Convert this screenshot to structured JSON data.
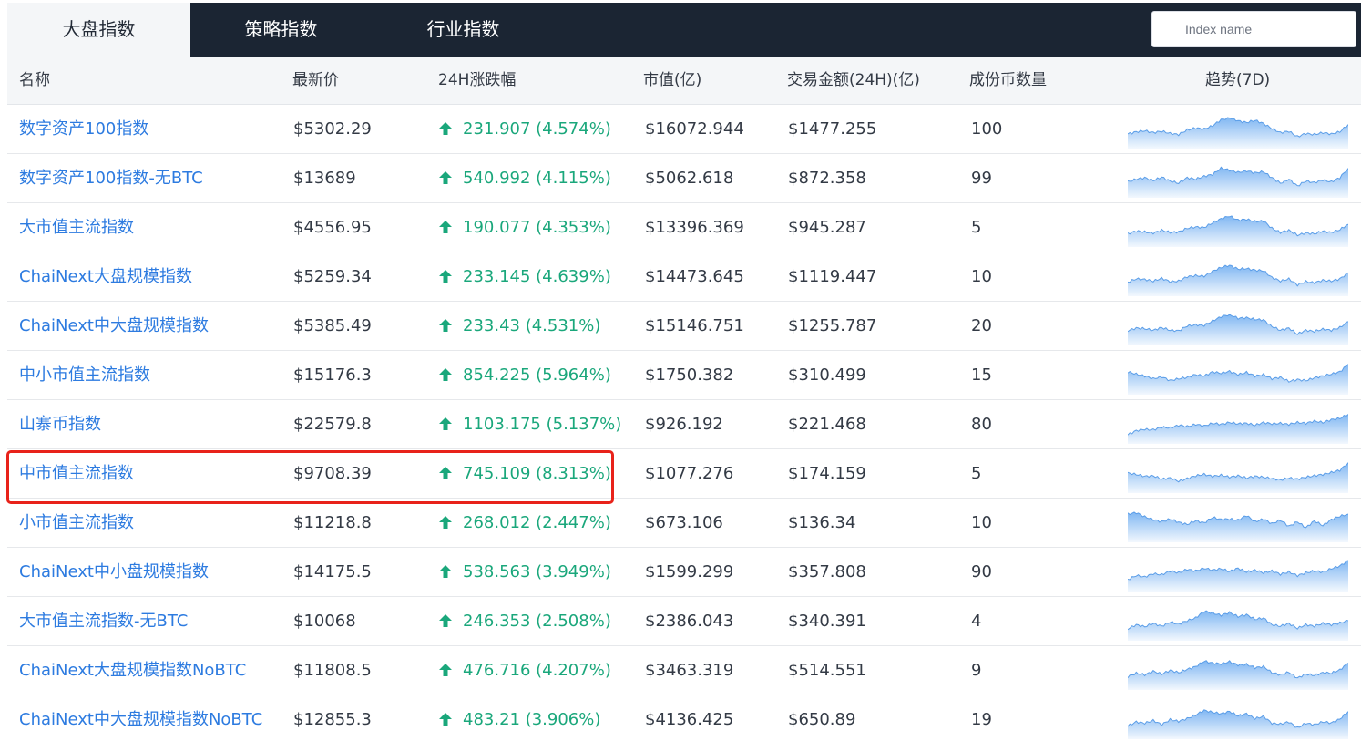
{
  "tabs": [
    {
      "label": "大盘指数",
      "active": true
    },
    {
      "label": "策略指数",
      "active": false
    },
    {
      "label": "行业指数",
      "active": false
    }
  ],
  "search": {
    "placeholder": "Index name",
    "value": ""
  },
  "columns": {
    "name": "名称",
    "price": "最新价",
    "change": "24H涨跌幅",
    "market_cap": "市值(亿)",
    "volume": "交易金额(24H)(亿)",
    "constituents": "成份币数量",
    "trend": "趋势(7D)"
  },
  "colors": {
    "link": "#2d7be0",
    "up": "#1aa77b",
    "header_bg": "#1b2533",
    "highlight": "#e8221a",
    "sparkline": "#6aaaf0"
  },
  "rows": [
    {
      "name": "数字资产100指数",
      "price": "$5302.29",
      "change": "231.907 (4.574%)",
      "direction": "up",
      "market_cap": "$16072.944",
      "volume": "$1477.255",
      "constituents": "100",
      "trend": [
        0.4,
        0.48,
        0.52,
        0.45,
        0.5,
        0.42,
        0.38,
        0.55,
        0.62,
        0.58,
        0.7,
        0.92,
        1.0,
        0.88,
        0.82,
        0.9,
        0.78,
        0.6,
        0.45,
        0.5,
        0.3,
        0.42,
        0.38,
        0.45,
        0.4,
        0.48,
        0.75
      ]
    },
    {
      "name": "数字资产100指数-无BTC",
      "price": "$13689",
      "change": "540.992 (4.115%)",
      "direction": "up",
      "market_cap": "$5062.618",
      "volume": "$872.358",
      "constituents": "99",
      "trend": [
        0.45,
        0.55,
        0.6,
        0.5,
        0.62,
        0.48,
        0.4,
        0.6,
        0.55,
        0.65,
        0.72,
        0.95,
        0.88,
        0.8,
        0.85,
        0.78,
        0.82,
        0.6,
        0.4,
        0.55,
        0.3,
        0.48,
        0.42,
        0.52,
        0.45,
        0.6,
        0.95
      ]
    },
    {
      "name": "大市值主流指数",
      "price": "$4556.95",
      "change": "190.077 (4.353%)",
      "direction": "up",
      "market_cap": "$13396.369",
      "volume": "$945.287",
      "constituents": "5",
      "trend": [
        0.35,
        0.45,
        0.42,
        0.38,
        0.48,
        0.4,
        0.42,
        0.55,
        0.6,
        0.58,
        0.75,
        0.9,
        1.0,
        0.85,
        0.88,
        0.8,
        0.82,
        0.55,
        0.4,
        0.48,
        0.3,
        0.38,
        0.35,
        0.45,
        0.4,
        0.5,
        0.7
      ]
    },
    {
      "name": "ChaiNext大盘规模指数",
      "price": "$5259.34",
      "change": "233.145 (4.639%)",
      "direction": "up",
      "market_cap": "$14473.645",
      "volume": "$1119.447",
      "constituents": "10",
      "trend": [
        0.38,
        0.5,
        0.48,
        0.42,
        0.52,
        0.4,
        0.42,
        0.58,
        0.62,
        0.6,
        0.78,
        0.92,
        1.0,
        0.86,
        0.88,
        0.82,
        0.8,
        0.55,
        0.42,
        0.5,
        0.28,
        0.4,
        0.36,
        0.45,
        0.42,
        0.5,
        0.72
      ]
    },
    {
      "name": "ChaiNext中大盘规模指数",
      "price": "$5385.49",
      "change": "233.43 (4.531%)",
      "direction": "up",
      "market_cap": "$15146.751",
      "volume": "$1255.787",
      "constituents": "20",
      "trend": [
        0.4,
        0.5,
        0.48,
        0.42,
        0.52,
        0.42,
        0.4,
        0.58,
        0.62,
        0.6,
        0.76,
        0.92,
        1.0,
        0.86,
        0.88,
        0.82,
        0.8,
        0.56,
        0.42,
        0.5,
        0.28,
        0.42,
        0.38,
        0.46,
        0.42,
        0.52,
        0.74
      ]
    },
    {
      "name": "中小市值主流指数",
      "price": "$15176.3",
      "change": "854.225 (5.964%)",
      "direction": "up",
      "market_cap": "$1750.382",
      "volume": "$310.499",
      "constituents": "15",
      "trend": [
        0.7,
        0.62,
        0.55,
        0.45,
        0.52,
        0.38,
        0.45,
        0.5,
        0.6,
        0.55,
        0.7,
        0.65,
        0.72,
        0.6,
        0.68,
        0.55,
        0.6,
        0.45,
        0.5,
        0.35,
        0.42,
        0.38,
        0.48,
        0.55,
        0.62,
        0.7,
        0.98
      ]
    },
    {
      "name": "山寨币指数",
      "price": "$22579.8",
      "change": "1103.175 (5.137%)",
      "direction": "up",
      "market_cap": "$926.192",
      "volume": "$221.468",
      "constituents": "80",
      "trend": [
        0.2,
        0.35,
        0.4,
        0.38,
        0.48,
        0.45,
        0.55,
        0.5,
        0.58,
        0.52,
        0.62,
        0.58,
        0.65,
        0.6,
        0.62,
        0.55,
        0.65,
        0.6,
        0.62,
        0.58,
        0.65,
        0.62,
        0.7,
        0.65,
        0.75,
        0.8,
        0.95
      ]
    },
    {
      "name": "中市值主流指数",
      "price": "$9708.39",
      "change": "745.109 (8.313%)",
      "direction": "up",
      "market_cap": "$1077.276",
      "volume": "$174.159",
      "constituents": "5",
      "trend": [
        0.6,
        0.55,
        0.48,
        0.5,
        0.38,
        0.42,
        0.3,
        0.4,
        0.5,
        0.55,
        0.48,
        0.52,
        0.45,
        0.5,
        0.42,
        0.48,
        0.45,
        0.4,
        0.35,
        0.42,
        0.38,
        0.45,
        0.5,
        0.55,
        0.62,
        0.7,
        0.98
      ]
    },
    {
      "name": "小市值主流指数",
      "price": "$11218.8",
      "change": "268.012 (2.447%)",
      "direction": "up",
      "market_cap": "$673.106",
      "volume": "$136.34",
      "constituents": "10",
      "trend": [
        0.9,
        0.95,
        0.8,
        0.7,
        0.62,
        0.72,
        0.6,
        0.52,
        0.66,
        0.58,
        0.78,
        0.7,
        0.72,
        0.68,
        0.85,
        0.62,
        0.72,
        0.55,
        0.68,
        0.45,
        0.62,
        0.4,
        0.65,
        0.48,
        0.7,
        0.82,
        0.9
      ]
    },
    {
      "name": "ChaiNext中小盘规模指数",
      "price": "$14175.5",
      "change": "538.563 (3.949%)",
      "direction": "up",
      "market_cap": "$1599.299",
      "volume": "$357.808",
      "constituents": "90",
      "trend": [
        0.3,
        0.45,
        0.4,
        0.52,
        0.48,
        0.62,
        0.55,
        0.68,
        0.62,
        0.72,
        0.65,
        0.7,
        0.6,
        0.72,
        0.58,
        0.65,
        0.55,
        0.62,
        0.5,
        0.58,
        0.45,
        0.55,
        0.62,
        0.58,
        0.7,
        0.8,
        1.0
      ]
    },
    {
      "name": "大市值主流指数-无BTC",
      "price": "$10068",
      "change": "246.353 (2.508%)",
      "direction": "up",
      "market_cap": "$2386.043",
      "volume": "$340.391",
      "constituents": "4",
      "trend": [
        0.3,
        0.45,
        0.38,
        0.5,
        0.4,
        0.55,
        0.48,
        0.6,
        0.7,
        0.95,
        0.88,
        0.8,
        0.9,
        0.75,
        0.82,
        0.65,
        0.7,
        0.45,
        0.4,
        0.5,
        0.32,
        0.45,
        0.4,
        0.5,
        0.45,
        0.52,
        0.6
      ]
    },
    {
      "name": "ChaiNext大盘规模指数NoBTC",
      "price": "$11808.5",
      "change": "476.716 (4.207%)",
      "direction": "up",
      "market_cap": "$3463.319",
      "volume": "$514.551",
      "constituents": "9",
      "trend": [
        0.35,
        0.48,
        0.42,
        0.55,
        0.45,
        0.58,
        0.5,
        0.62,
        0.72,
        0.92,
        0.85,
        0.82,
        0.9,
        0.78,
        0.8,
        0.68,
        0.72,
        0.5,
        0.42,
        0.52,
        0.3,
        0.45,
        0.4,
        0.5,
        0.48,
        0.6,
        0.85
      ]
    },
    {
      "name": "ChaiNext中大盘规模指数NoBTC",
      "price": "$12855.3",
      "change": "483.21 (3.906%)",
      "direction": "up",
      "market_cap": "$4136.425",
      "volume": "$650.89",
      "constituents": "19",
      "trend": [
        0.35,
        0.5,
        0.45,
        0.55,
        0.4,
        0.58,
        0.52,
        0.62,
        0.75,
        0.92,
        0.85,
        0.8,
        0.88,
        0.72,
        0.8,
        0.62,
        0.7,
        0.45,
        0.42,
        0.5,
        0.28,
        0.45,
        0.4,
        0.5,
        0.46,
        0.6,
        0.88
      ]
    }
  ],
  "highlighted_row_index": 7
}
